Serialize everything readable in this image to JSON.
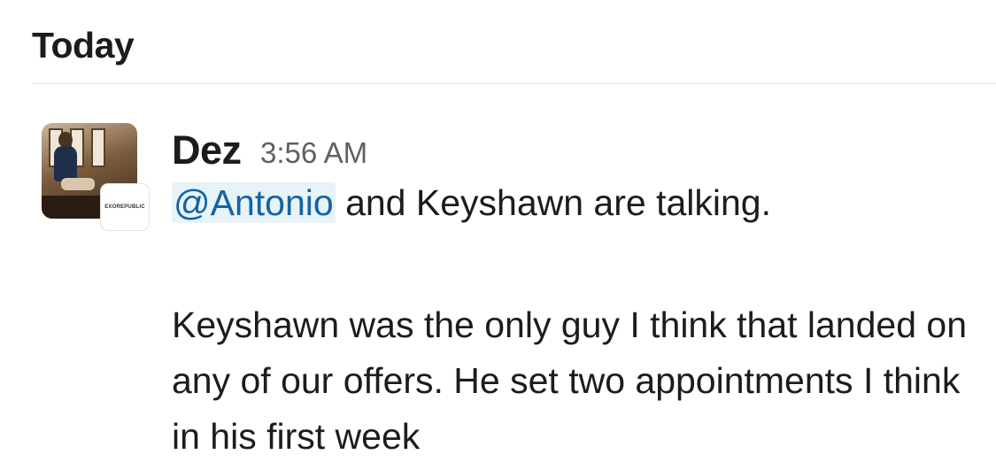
{
  "day_header": "Today",
  "message": {
    "author": "Dez",
    "timestamp": "3:56 AM",
    "avatar_badge_text": "EXOREPUBLIC",
    "mention": "@Antonio",
    "line1_rest": " and Keyshawn are talking.",
    "paragraph": "Keyshawn was the only guy I think that landed on any of our offers. He set two appointments I think in his first week"
  },
  "colors": {
    "mention_text": "#1264a3",
    "mention_bg": "#e8f3f8",
    "timestamp": "#616061",
    "text": "#1d1c1d"
  }
}
